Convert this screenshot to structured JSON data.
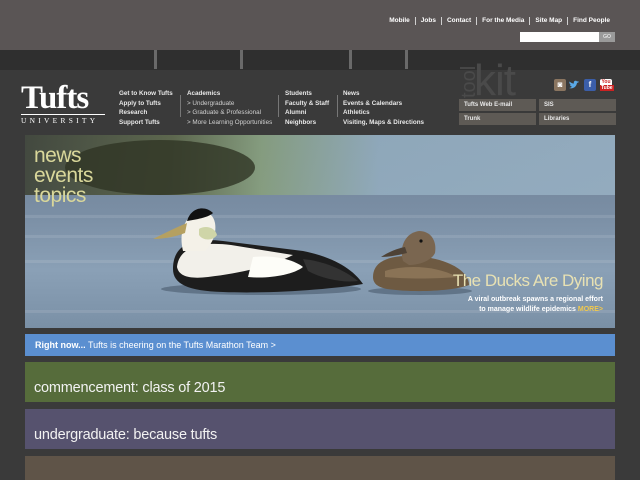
{
  "utility_links": [
    "Mobile",
    "Jobs",
    "Contact",
    "For the Media",
    "Site Map",
    "Find People"
  ],
  "search": {
    "value": "",
    "button_label": "GO"
  },
  "logo": {
    "word": "Tufts",
    "sub": "UNIVERSITY"
  },
  "nav": {
    "col1": [
      "Get to Know Tufts",
      "Apply to Tufts",
      "Research",
      "Support Tufts"
    ],
    "col2_title": "Academics",
    "col2": [
      "> Undergraduate",
      "> Graduate & Professional",
      "> More Learning Opportunities"
    ],
    "col3": [
      "Students",
      "Faculty & Staff",
      "Alumni",
      "Neighbors"
    ],
    "col4": [
      "News",
      "Events & Calendars",
      "Athletics",
      "Visiting, Maps & Directions"
    ]
  },
  "toolkit": {
    "tool": "tool",
    "kit": "kit",
    "buttons": [
      "Tufts Web E-mail",
      "SIS",
      "Trunk",
      "Libraries"
    ]
  },
  "social_icons": [
    "instagram-icon",
    "twitter-icon",
    "facebook-icon",
    "youtube-icon"
  ],
  "hero": {
    "words": [
      "news",
      "events",
      "topics"
    ],
    "headline": "The Ducks Are Dying",
    "dek_line1": "A viral outbreak spawns a regional effort",
    "dek_line2": "to manage wildlife epidemics",
    "more": "MORE>"
  },
  "right_now": {
    "label": "Right now...",
    "text": "Tufts is cheering on the Tufts Marathon Team  >"
  },
  "blocks": [
    {
      "label": "commencement: class of 2015",
      "color": "#566c3b"
    },
    {
      "label": "undergraduate: because tufts",
      "color": "#56526e"
    },
    {
      "label": "",
      "color": "#5f5448"
    }
  ]
}
